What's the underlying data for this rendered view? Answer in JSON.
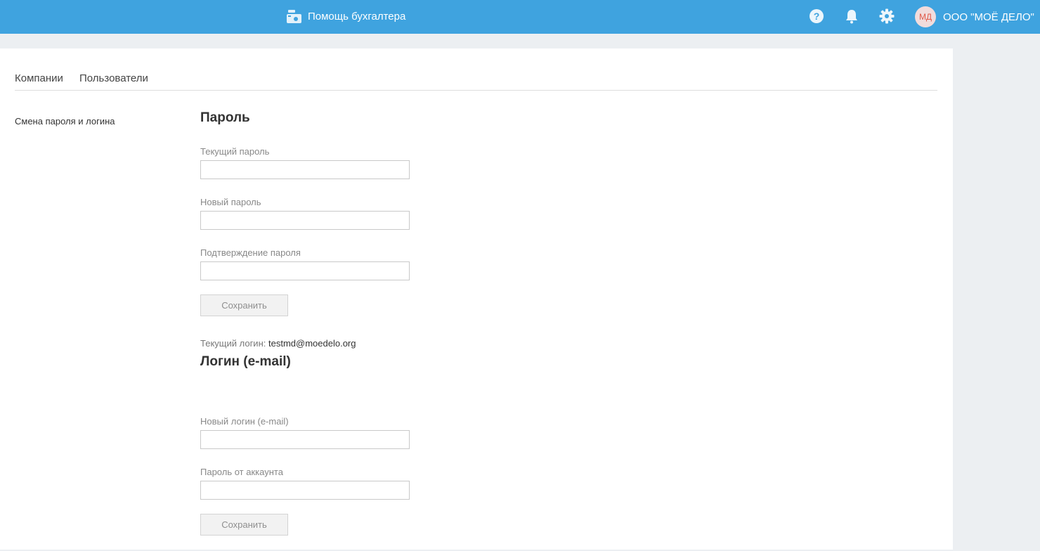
{
  "header": {
    "helper_label": "Помощь бухгалтера",
    "company": "ООО \"МОЁ ДЕЛО\"",
    "avatar_initials": "МД",
    "brand_color": "#3fa3df",
    "icons": [
      "help-icon",
      "bell-icon",
      "gear-icon"
    ]
  },
  "tabs": [
    {
      "label": "Компании"
    },
    {
      "label": "Пользователи"
    }
  ],
  "sidebar": {
    "link": "Смена пароля и логина"
  },
  "password_section": {
    "title": "Пароль",
    "current_label": "Текущий пароль",
    "new_label": "Новый пароль",
    "confirm_label": "Подтверждение пароля",
    "current_value": "",
    "new_value": "",
    "confirm_value": "",
    "save": "Сохранить"
  },
  "login_section": {
    "title": "Логин (e-mail)",
    "current_key": "Текущий логин:",
    "current_value": "testmd@moedelo.org",
    "new_label": "Новый логин (e-mail)",
    "password_label": "Пароль от аккаунта",
    "new_value": "",
    "password_value": "",
    "save": "Сохранить"
  }
}
